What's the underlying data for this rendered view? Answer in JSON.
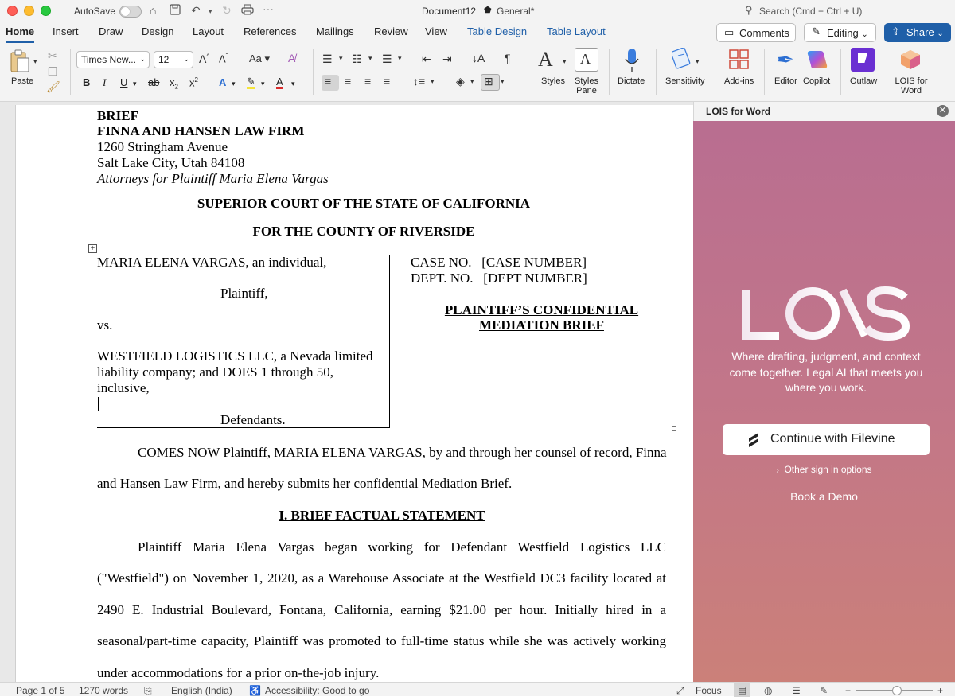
{
  "titlebar": {
    "autosave_label": "AutoSave",
    "doc_title": "Document12",
    "sensitivity": "General*",
    "search_placeholder": "Search (Cmd + Ctrl + U)"
  },
  "tabs": [
    "Home",
    "Insert",
    "Draw",
    "Design",
    "Layout",
    "References",
    "Mailings",
    "Review",
    "View",
    "Table Design",
    "Table Layout"
  ],
  "header_buttons": {
    "comments": "Comments",
    "editing": "Editing",
    "share": "Share"
  },
  "ribbon": {
    "paste": "Paste",
    "font_name": "Times New...",
    "font_size": "12",
    "styles": "Styles",
    "styles_pane": "Styles Pane",
    "dictate": "Dictate",
    "sensitivity": "Sensitivity",
    "addins": "Add-ins",
    "editor": "Editor",
    "copilot": "Copilot",
    "outlaw": "Outlaw",
    "lois_for_word": "LOIS for Word"
  },
  "document": {
    "line_brief": "BRIEF",
    "firm_name": "FINNA AND HANSEN LAW FIRM",
    "address1": "1260 Stringham Avenue",
    "address2": "Salt Lake City, Utah 84108",
    "attorneys": "Attorneys for Plaintiff Maria Elena Vargas",
    "court1": "SUPERIOR COURT OF THE STATE OF CALIFORNIA",
    "court2": "FOR THE COUNTY OF RIVERSIDE",
    "plaintiff_name": "MARIA ELENA VARGAS, an individual,",
    "plaintiff_role": "Plaintiff,",
    "vs": "vs.",
    "defendant_l1": "WESTFIELD LOGISTICS LLC, a Nevada limited",
    "defendant_l2": "liability company; and DOES 1 through 50,",
    "defendant_l3": "inclusive,",
    "defendant_role": "Defendants.",
    "case_no": "CASE NO.   [CASE NUMBER]",
    "dept_no": "DEPT. NO.   [DEPT NUMBER]",
    "doc_title1": "PLAINTIFF’S CONFIDENTIAL",
    "doc_title2": "MEDIATION BRIEF",
    "intro_l1": "COMES NOW Plaintiff, MARIA ELENA VARGAS, by and through her counsel of record, Finna",
    "intro_l2": "and Hansen Law Firm, and hereby submits her confidential Mediation Brief.",
    "section1": "I.  BRIEF FACTUAL STATEMENT",
    "para_l1": "Plaintiff Maria Elena Vargas began working for Defendant Westfield Logistics LLC",
    "para_l2": "(\"Westfield\") on November 1, 2020, as a Warehouse Associate at the Westfield DC3 facility located at",
    "para_l3": "2490 E. Industrial Boulevard, Fontana, California, earning $21.00 per hour. Initially hired in a",
    "para_l4": "seasonal/part-time capacity, Plaintiff was promoted to full-time status while she was actively working",
    "para_l5": "under accommodations for a prior on-the-job injury."
  },
  "pane": {
    "title": "LOIS for Word",
    "tagline": "Where drafting, judgment, and context come together. Legal AI that meets you where you work.",
    "continue_button": "Continue with Filevine",
    "other_signin": "Other sign in options",
    "book_demo": "Book a Demo"
  },
  "status": {
    "page": "Page 1 of 5",
    "words": "1270 words",
    "language": "English (India)",
    "accessibility": "Accessibility: Good to go",
    "focus": "Focus"
  },
  "colors": {
    "accent": "#1f5fa8",
    "pane_top": "#b86d91",
    "pane_bottom": "#cb8079"
  }
}
